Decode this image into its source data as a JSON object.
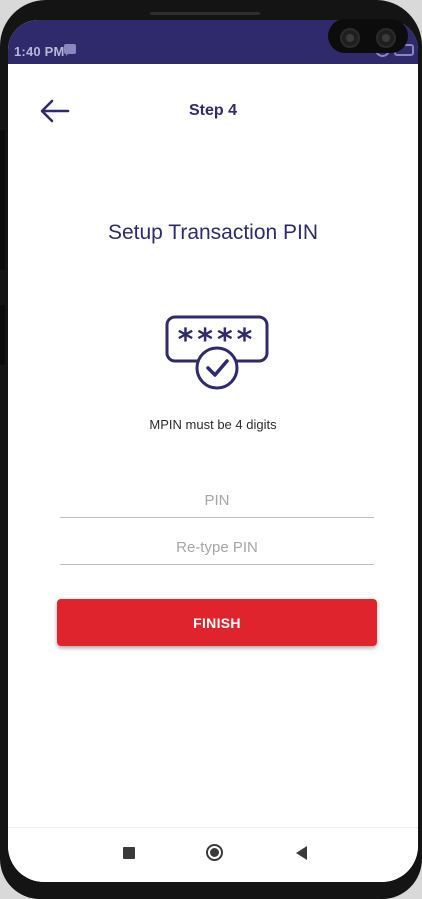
{
  "status_bar": {
    "time": "1:40 PM",
    "icons": [
      "message-icon",
      "alarm-icon",
      "battery-icon"
    ]
  },
  "header": {
    "back_icon": "arrow-left-icon",
    "title": "Step 4"
  },
  "main": {
    "heading": "Setup Transaction PIN",
    "illustration": {
      "icon": "pin-check-icon",
      "pin_mask": "****"
    },
    "hint": "MPIN must be 4 digits",
    "pin_field": {
      "placeholder": "PIN",
      "value": ""
    },
    "retype_field": {
      "placeholder": "Re-type PIN",
      "value": ""
    },
    "finish_label": "FINISH"
  },
  "nav_bar": {
    "icons": [
      "recents-icon",
      "home-icon",
      "back-icon"
    ]
  },
  "colors": {
    "brand": "#2f2a6b",
    "accent": "#e0242d",
    "status_bar": "#2f2a6b"
  }
}
